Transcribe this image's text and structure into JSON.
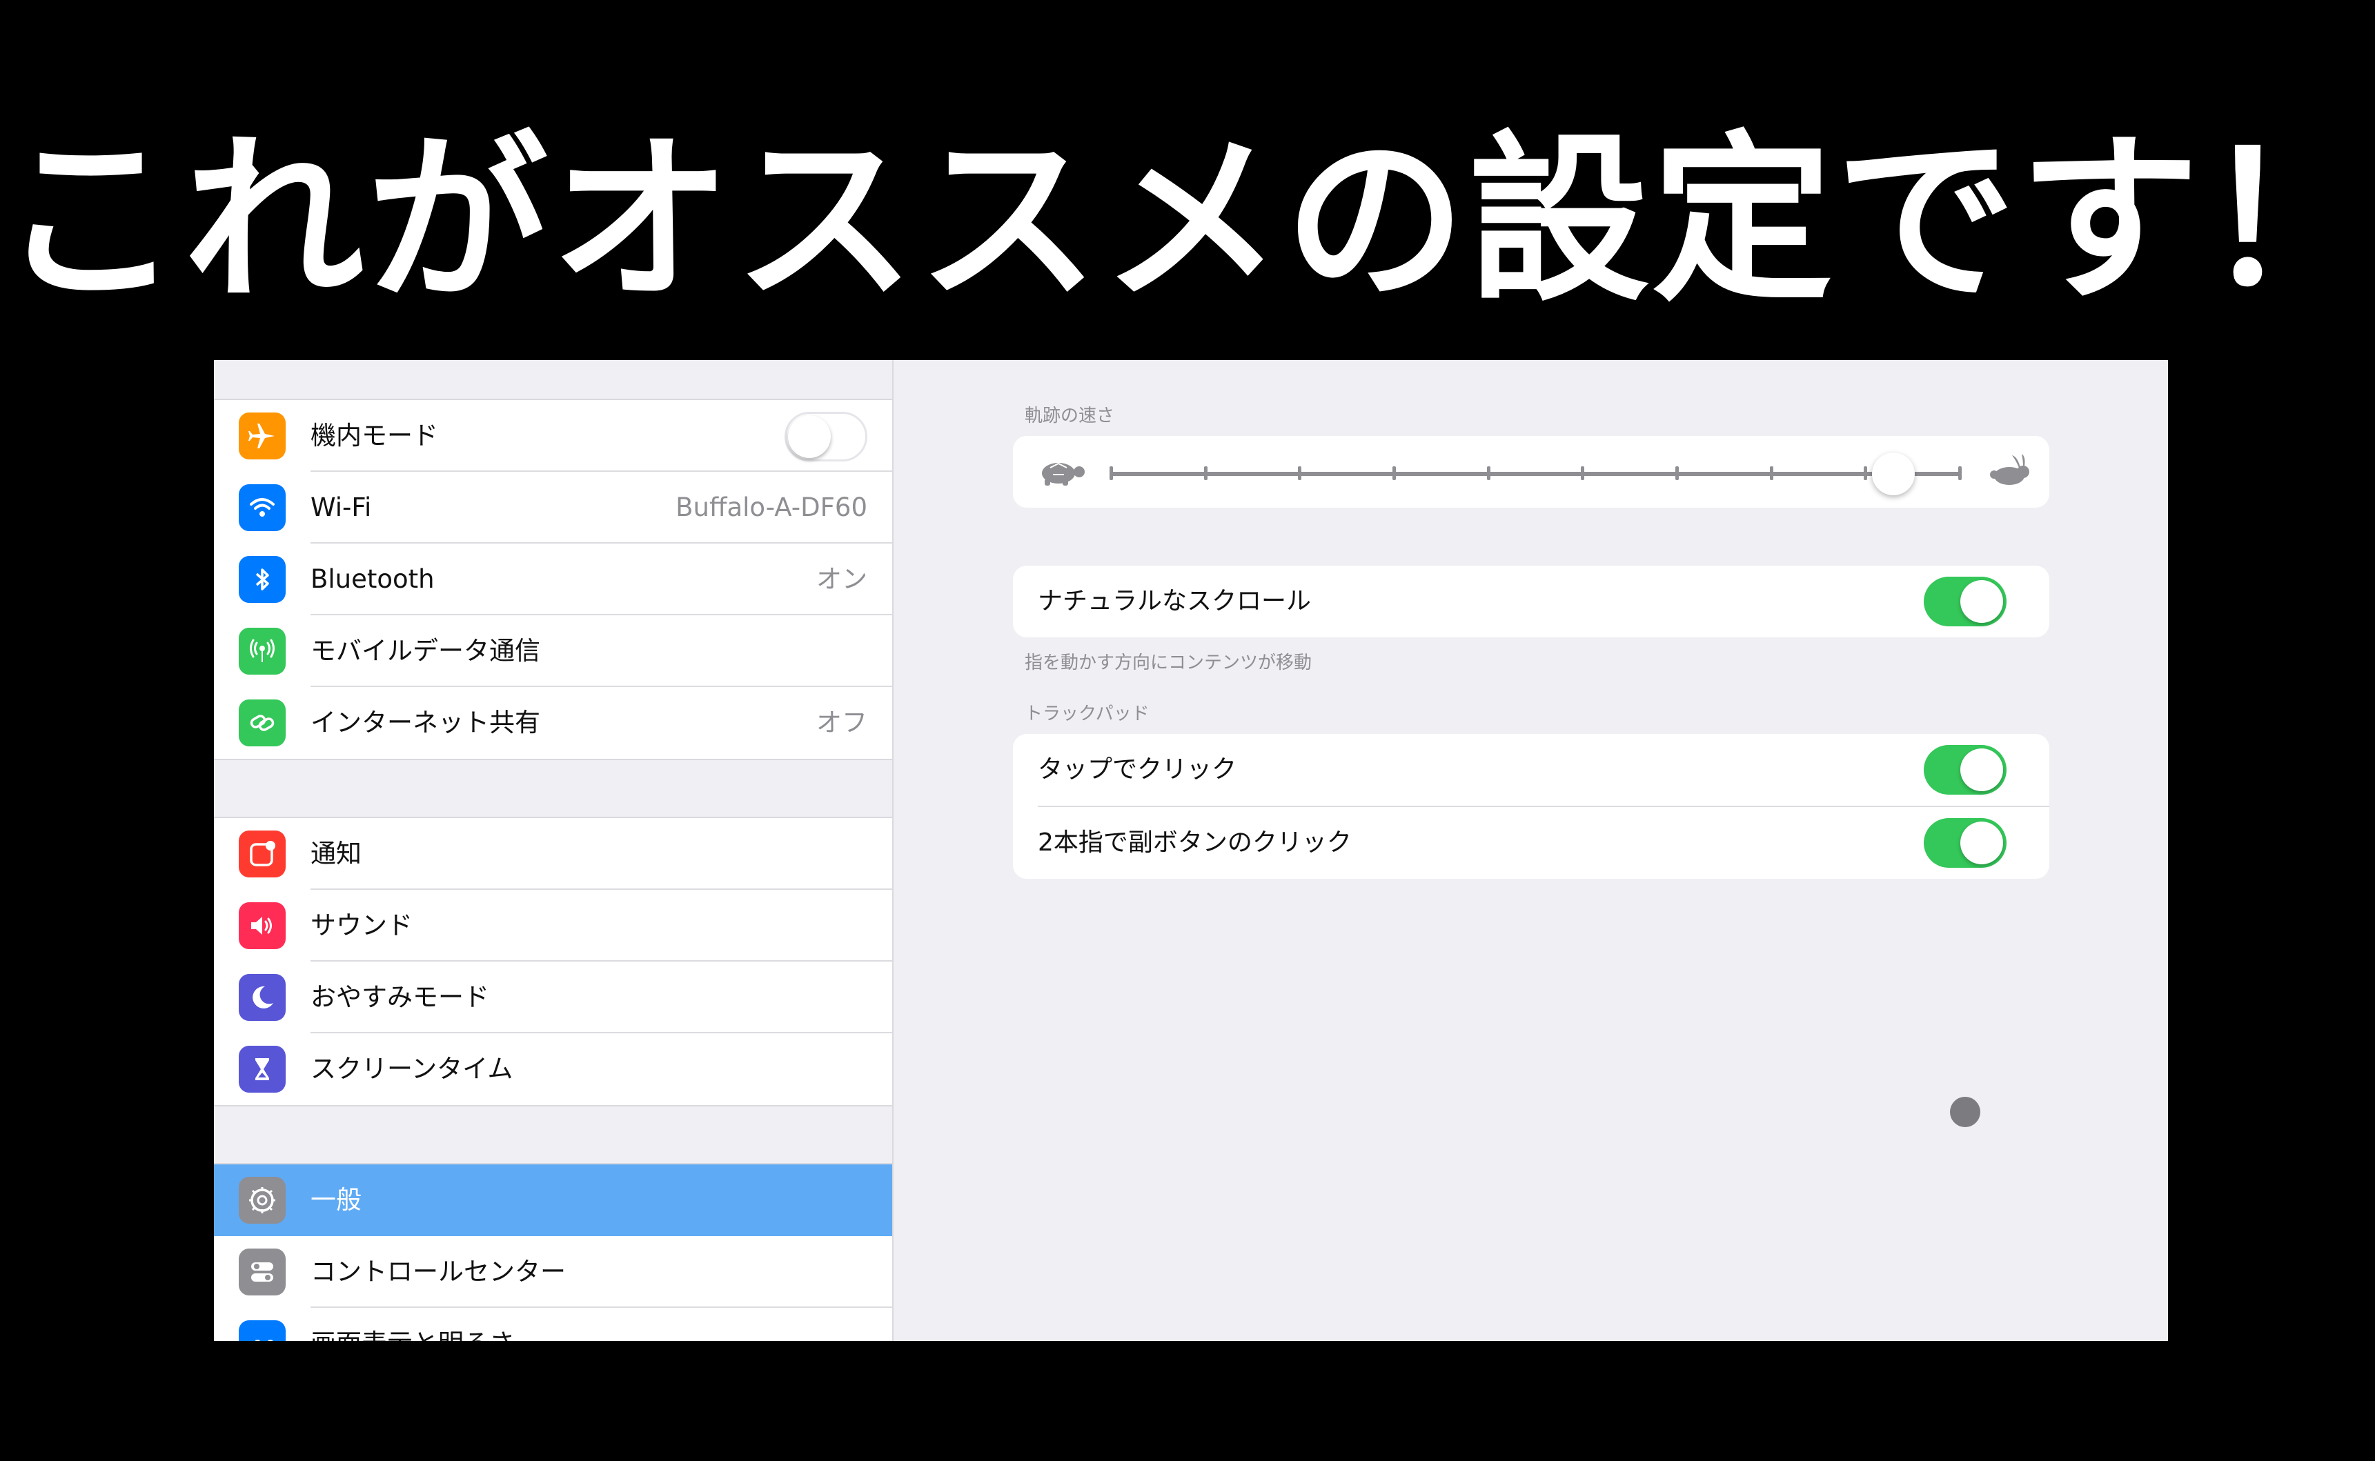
{
  "headline": "これがオススメの設定です！",
  "sidebar": {
    "group1": [
      {
        "label": "機内モード",
        "value": "",
        "icon": "airplane-icon",
        "color": "#ff9500"
      },
      {
        "label": "Wi-Fi",
        "value": "Buffalo-A-DF60",
        "icon": "wifi-icon",
        "color": "#007aff"
      },
      {
        "label": "Bluetooth",
        "value": "オン",
        "icon": "bluetooth-icon",
        "color": "#007aff"
      },
      {
        "label": "モバイルデータ通信",
        "value": "",
        "icon": "antenna-icon",
        "color": "#34c759"
      },
      {
        "label": "インターネット共有",
        "value": "オフ",
        "icon": "link-icon",
        "color": "#34c759"
      }
    ],
    "group2": [
      {
        "label": "通知",
        "icon": "notifications-icon",
        "color": "#ff3b30"
      },
      {
        "label": "サウンド",
        "icon": "speaker-icon",
        "color": "#ff2d55"
      },
      {
        "label": "おやすみモード",
        "icon": "moon-icon",
        "color": "#5856d6"
      },
      {
        "label": "スクリーンタイム",
        "icon": "hourglass-icon",
        "color": "#5856d6"
      }
    ],
    "group3": [
      {
        "label": "一般",
        "icon": "gear-icon",
        "color": "#8e8e93",
        "selected": true
      },
      {
        "label": "コントロールセンター",
        "icon": "switches-icon",
        "color": "#8e8e93"
      },
      {
        "label": "画面表示と明るさ",
        "icon": "text-size-icon",
        "color": "#007aff"
      }
    ],
    "airplane_mode_on": false
  },
  "detail": {
    "tracking_speed_label": "軌跡の速さ",
    "tracking_speed_value": 0.92,
    "tracking_ticks": 10,
    "slow_icon": "turtle-icon",
    "fast_icon": "rabbit-icon",
    "natural_scroll_label": "ナチュラルなスクロール",
    "natural_scroll_on": true,
    "natural_scroll_footer": "指を動かす方向にコンテンツが移動",
    "trackpad_section": "トラックパッド",
    "tap_to_click_label": "タップでクリック",
    "tap_to_click_on": true,
    "two_finger_label": "2本指で副ボタンのクリック",
    "two_finger_on": true
  }
}
